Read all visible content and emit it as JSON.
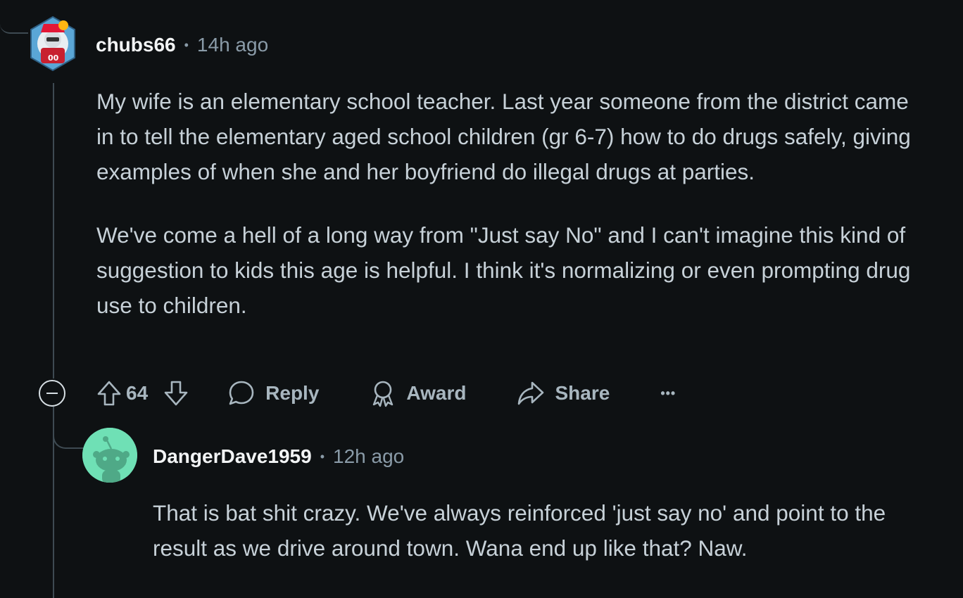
{
  "comment": {
    "username": "chubs66",
    "separator": "•",
    "time": "14h ago",
    "paragraphs": [
      "My wife is an elementary school teacher. Last year someone from the district came in to tell the elementary aged school children (gr 6-7) how to do drugs safely, giving examples of when she and her boyfriend do illegal drugs at parties.",
      "We've come a hell of a long way from \"Just say No\" and I can't imagine this kind of suggestion to kids this age is helpful. I think it's normalizing or even prompting drug use to children."
    ],
    "score": "64",
    "reply_label": "Reply",
    "award_label": "Award",
    "share_label": "Share",
    "more_label": "•••"
  },
  "reply": {
    "username": "DangerDave1959",
    "separator": "•",
    "time": "12h ago",
    "paragraphs": [
      "That is bat shit crazy. We've always reinforced 'just say no' and point to the result as we drive around town. Wana end up like that? Naw."
    ]
  },
  "colors": {
    "background": "#0e1113",
    "thread_line": "#3e4a52",
    "username": "#f2f4f5",
    "meta": "#8a9ba8",
    "body_text": "#c7d1d8",
    "action_text": "#a8b6bf",
    "reply_avatar_bg": "#6fe0b5"
  },
  "icons": {
    "collapse": "minus-circle-icon",
    "upvote": "arrow-up-icon",
    "downvote": "arrow-down-icon",
    "reply": "speech-bubble-icon",
    "award": "award-ribbon-icon",
    "share": "share-arrow-icon",
    "more": "ellipsis-icon"
  }
}
